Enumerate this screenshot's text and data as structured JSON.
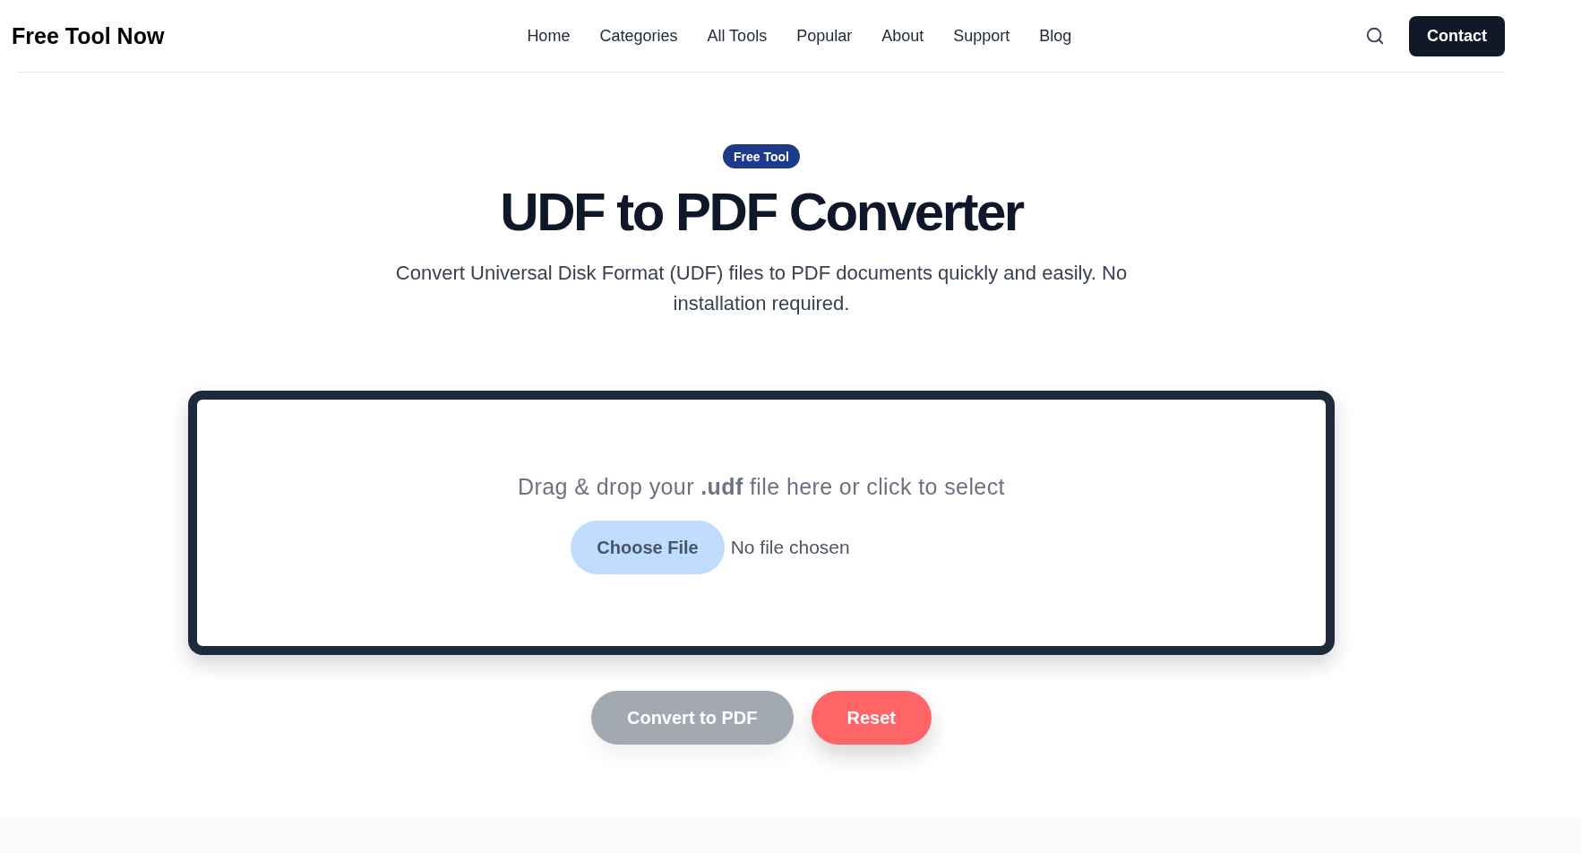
{
  "header": {
    "logo": "Free Tool Now",
    "nav": [
      "Home",
      "Categories",
      "All Tools",
      "Popular",
      "About",
      "Support",
      "Blog"
    ],
    "contact_button": "Contact"
  },
  "hero": {
    "badge": "Free Tool",
    "title": "UDF to PDF Converter",
    "subtitle": "Convert Universal Disk Format (UDF) files to PDF documents quickly and easily. No installation required."
  },
  "upload": {
    "prompt": "Drag & drop your **.udf** file here or click to select",
    "file_button": "Choose File",
    "file_status": "No file chosen"
  },
  "actions": [
    {
      "kind": "primary",
      "label": "Convert to PDF",
      "disabled": true
    },
    {
      "kind": "danger",
      "label": "Reset",
      "disabled": false
    }
  ]
}
